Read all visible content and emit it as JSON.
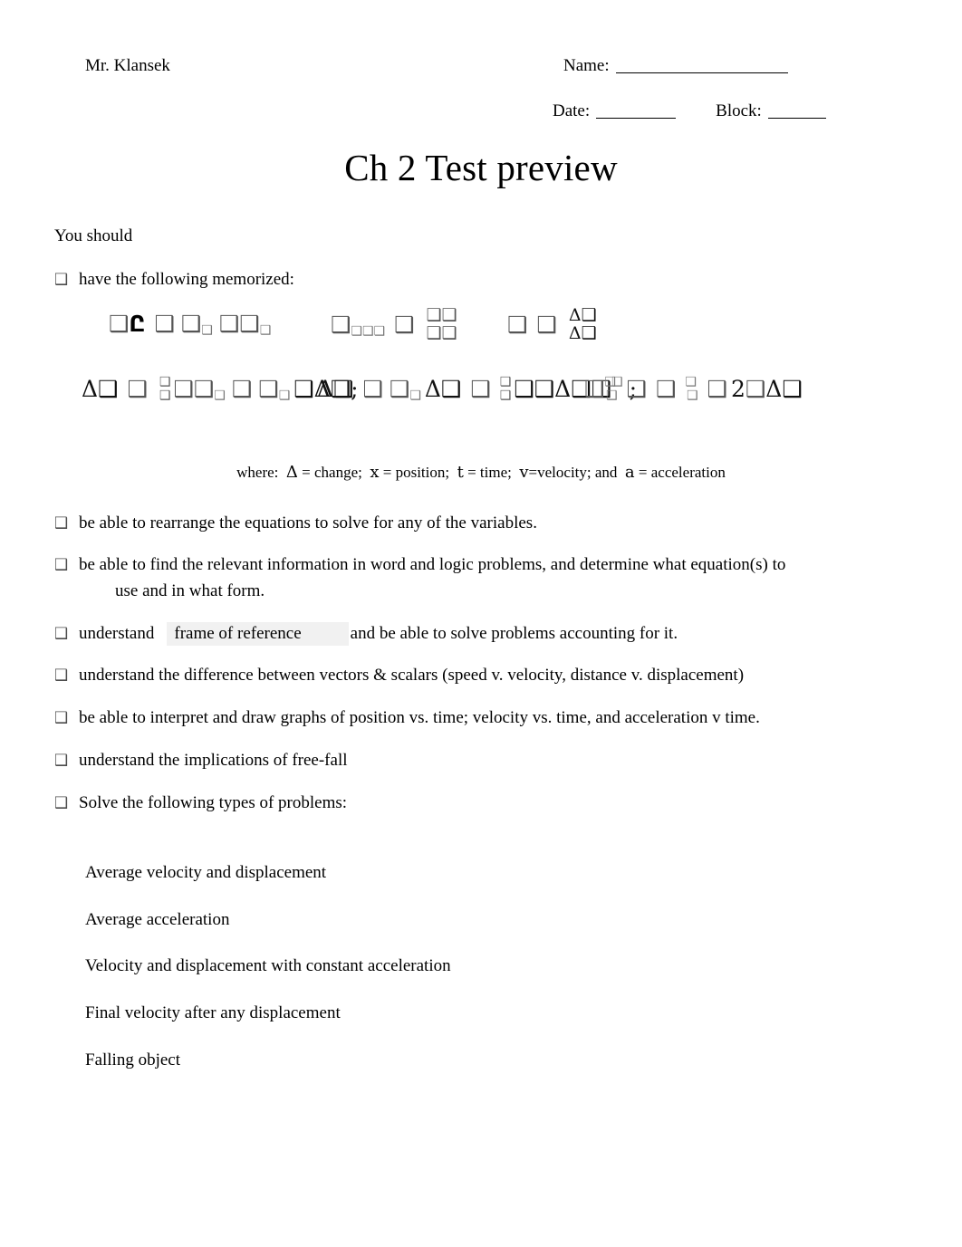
{
  "header": {
    "teacher": "Mr. Klansek",
    "name_label": "Name:",
    "date_label": "Date:",
    "block_label": "Block:"
  },
  "title": "Ch 2 Test preview",
  "intro": "You should",
  "bullets": [
    {
      "marker": "❑",
      "text": "have the following memorized:"
    },
    {
      "marker": "❑",
      "text": "be able to rearrange the equations to solve for any of the variables."
    },
    {
      "marker": "❑",
      "text": "be able to find the relevant information in word and logic problems, and determine what equation(s) to",
      "continuation": "use and in what form."
    },
    {
      "marker": "❑",
      "text_before": "understand",
      "highlight": "frame of reference",
      "text_after": "and be able to solve problems accounting for it."
    },
    {
      "marker": "❑",
      "text": "understand the difference between vectors & scalars (speed v. velocity, distance v. displacement)"
    },
    {
      "marker": "❑",
      "text": "be able to interpret and draw graphs of position vs. time; velocity vs. time, and acceleration v time."
    },
    {
      "marker": "❑",
      "text": "understand the implications of free-fall"
    },
    {
      "marker": "❑",
      "text": "Solve the following types of problems:"
    }
  ],
  "equations": {
    "note": "Equation-editor glyphs failed to render; most symbols appear as missing-glyph boxes.",
    "tofu": "❑",
    "delta": "Δ",
    "row1": [
      {
        "id": "avg-velocity",
        "parts": [
          "❑",
          "Ը",
          "❑",
          "❑",
          "❑",
          "❑",
          "❑",
          "❑"
        ]
      },
      {
        "id": "avg-accel-fraction",
        "lead": "❑",
        "lead_sub": "❑❑❑",
        "equals": "❑",
        "numerator": "❑❑",
        "denominator": "❑❑"
      },
      {
        "id": "delta-fraction",
        "lead": "❑",
        "equals": "❑",
        "numerator": "Δ❑",
        "denominator": "Δ❑"
      }
    ],
    "row2": [
      {
        "id": "displacement-eqn",
        "tokens": [
          "Δ❑",
          "❑",
          "FRAC_HALF",
          "❑❑",
          "❑",
          "❑",
          "❑",
          "❑",
          "❑Δ❑"
        ],
        "terminator": ";"
      },
      {
        "id": "displacement-eqn-2",
        "tokens": [
          "Δ❑",
          "❑",
          "❑",
          "❑",
          "Δ❑",
          "❑",
          "FRAC_HALF",
          "❑❑Δ❑❑",
          "❑"
        ],
        "terminator": ";"
      },
      {
        "id": "final-velocity-eqn",
        "tokens": [
          "❑",
          "❑",
          "❑",
          "❑",
          "❑",
          "❑",
          "2",
          "❑",
          "Δ❑"
        ]
      }
    ]
  },
  "where_line": {
    "prefix": "where:",
    "definitions": [
      {
        "symbol": "Δ",
        "text": "= change;"
      },
      {
        "symbol": "x",
        "text": "= position;"
      },
      {
        "symbol": "t",
        "text": "= time;"
      },
      {
        "symbol": "v",
        "text": "=velocity; and"
      },
      {
        "symbol": "a",
        "text": "= acceleration"
      }
    ]
  },
  "problem_types": [
    "Average velocity and displacement",
    "Average acceleration",
    "Velocity and displacement with constant acceleration",
    "Final velocity after any displacement",
    "Falling object"
  ]
}
